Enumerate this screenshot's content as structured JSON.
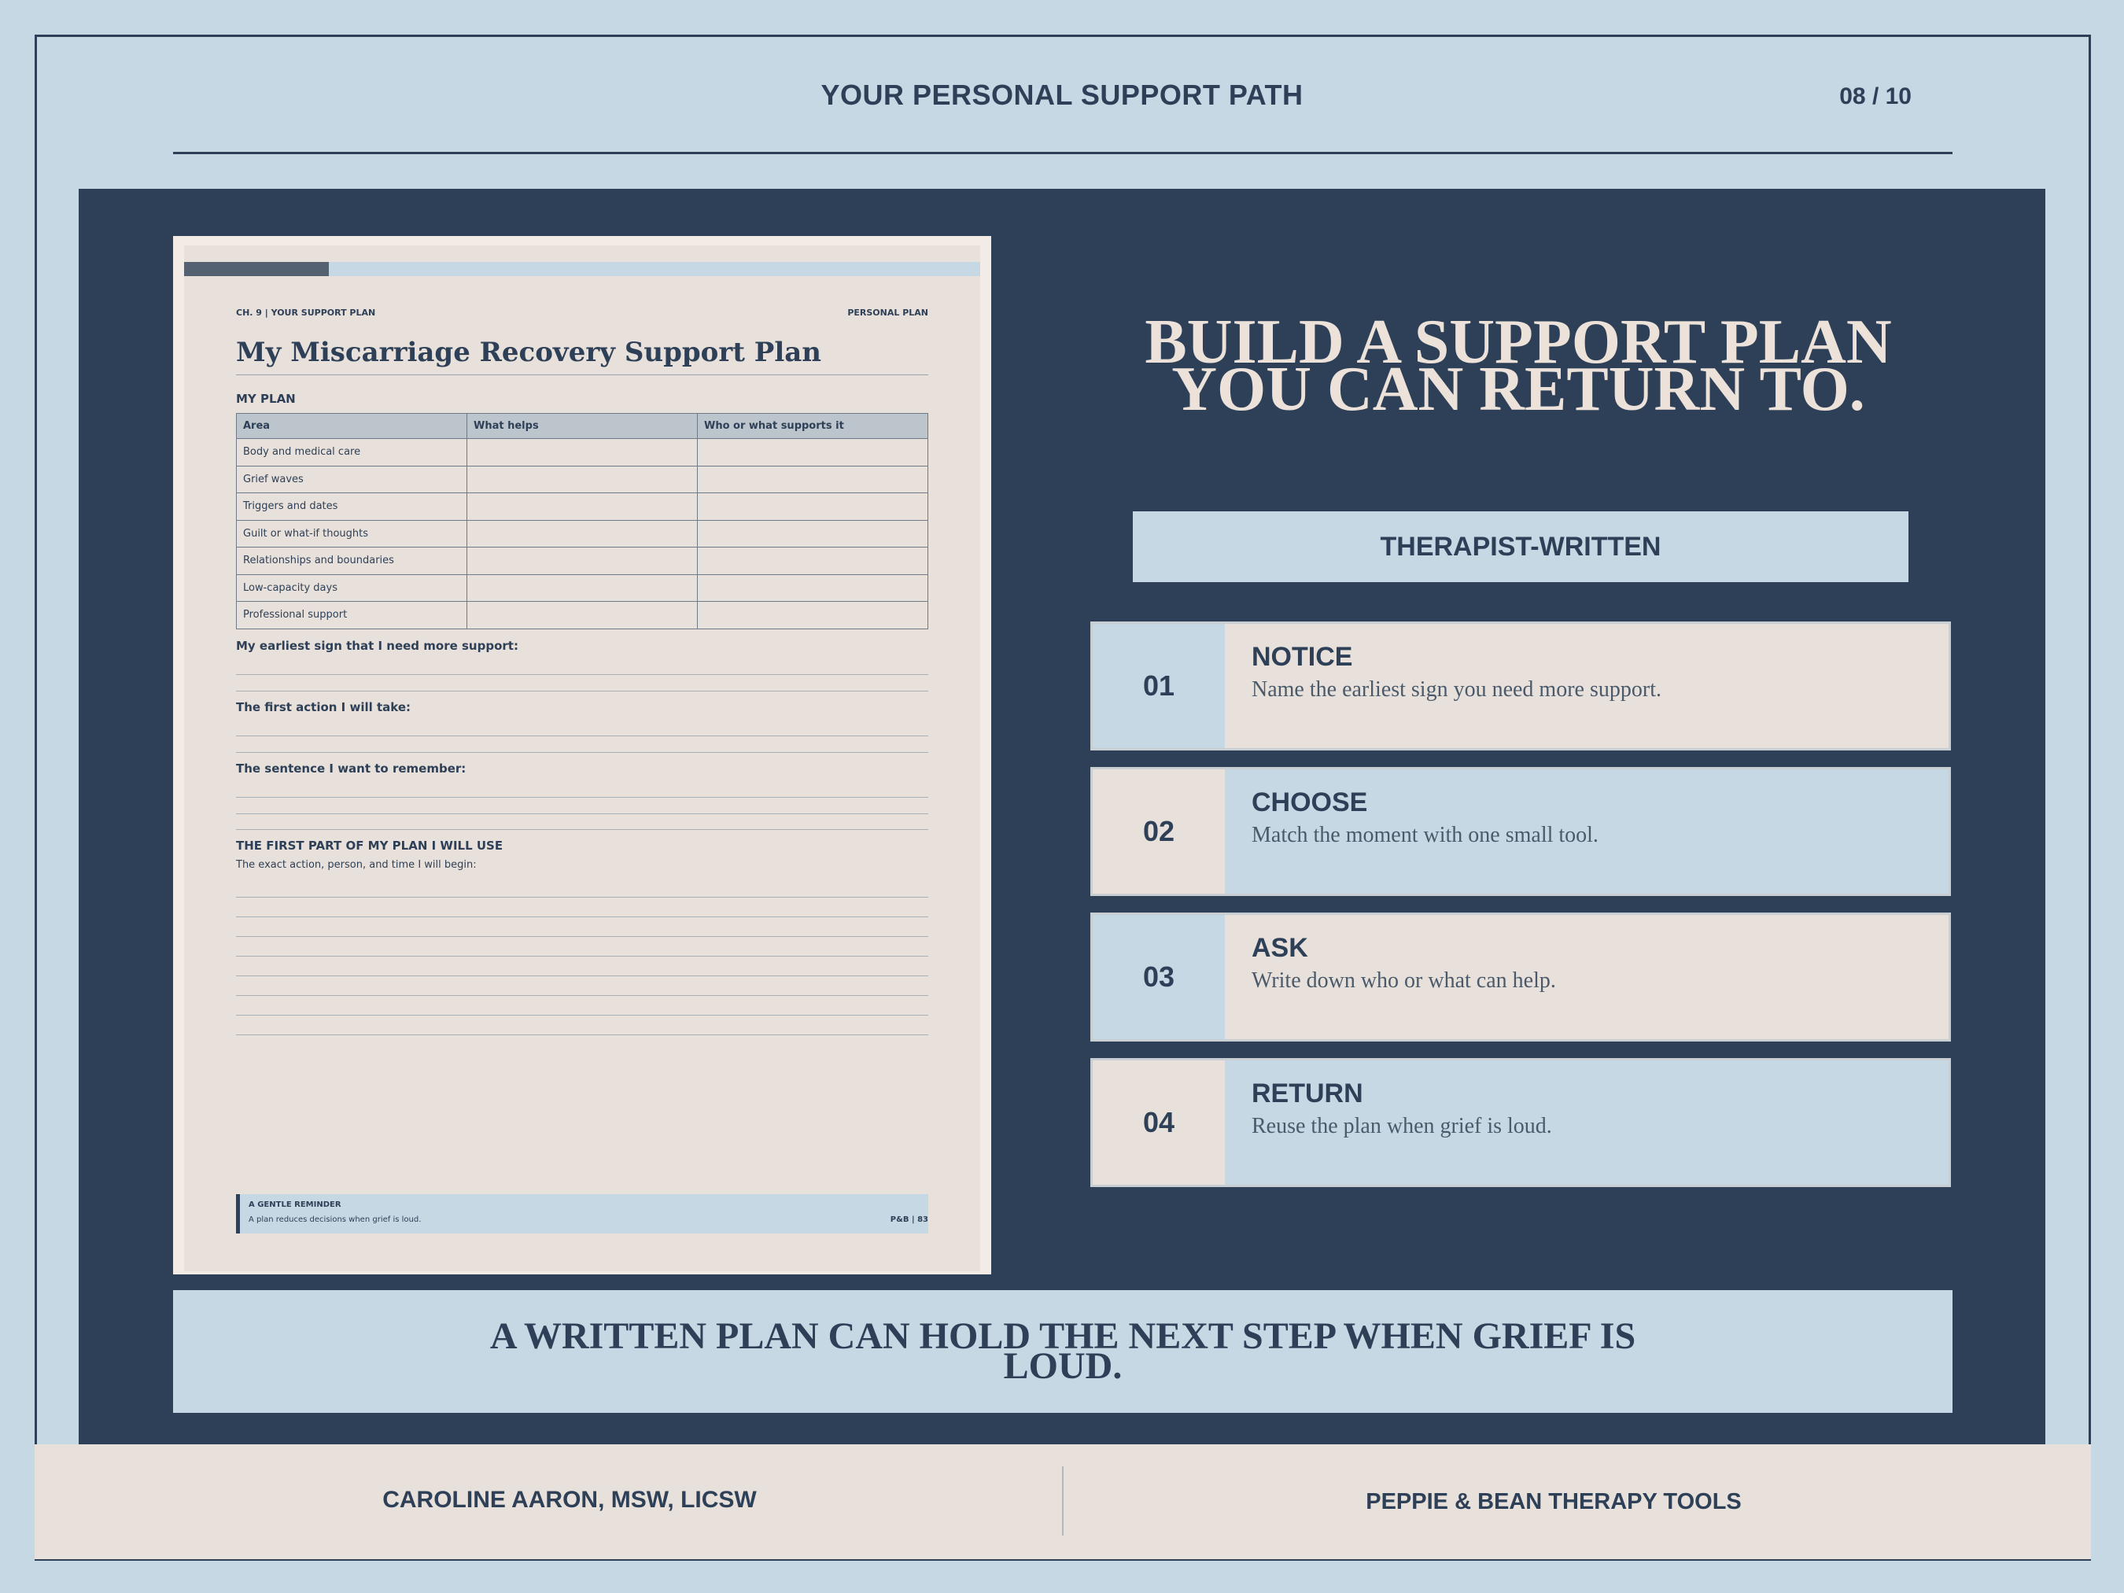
{
  "header": {
    "title": "YOUR PERSONAL SUPPORT PATH",
    "page": "08 / 10"
  },
  "worksheet": {
    "chapter": "CH. 9 | YOUR SUPPORT PLAN",
    "tag": "PERSONAL PLAN",
    "title": "My Miscarriage Recovery Support Plan",
    "section_label": "MY PLAN",
    "table": {
      "headers": [
        "Area",
        "What helps",
        "Who or what supports it"
      ],
      "rows": [
        "Body and medical care",
        "Grief waves",
        "Triggers and dates",
        "Guilt or what-if thoughts",
        "Relationships and boundaries",
        "Low-capacity days",
        "Professional support"
      ]
    },
    "prompts": [
      "My earliest sign that I need more support:",
      "The first action I will take:",
      "The sentence I want to remember:"
    ],
    "first_part_title": "THE FIRST PART OF MY PLAN I WILL USE",
    "first_part_caption": "The exact action, person, and time I will begin:",
    "reminder": {
      "title": "A GENTLE REMINDER",
      "text": "A plan reduces decisions when grief is loud.",
      "page": "P&B | 83"
    }
  },
  "headline": {
    "line1": "BUILD A SUPPORT PLAN",
    "line2": "YOU CAN RETURN TO."
  },
  "badge": "THERAPIST-WRITTEN",
  "steps": [
    {
      "num": "01",
      "title": "NOTICE",
      "desc": "Name the earliest sign you need more support."
    },
    {
      "num": "02",
      "title": "CHOOSE",
      "desc": "Match the moment with one small tool."
    },
    {
      "num": "03",
      "title": "ASK",
      "desc": "Write down who or what can help."
    },
    {
      "num": "04",
      "title": "RETURN",
      "desc": "Reuse the plan when grief is loud."
    }
  ],
  "banner": "A WRITTEN PLAN CAN HOLD THE NEXT STEP WHEN GRIEF IS LOUD.",
  "footer": {
    "left": "CAROLINE AARON, MSW, LICSW",
    "right": "PEPPIE & BEAN THERAPY TOOLS"
  },
  "colors": {
    "navy": "#2e4057",
    "light_blue": "#c5d8e4",
    "beige": "#e8e0da"
  }
}
